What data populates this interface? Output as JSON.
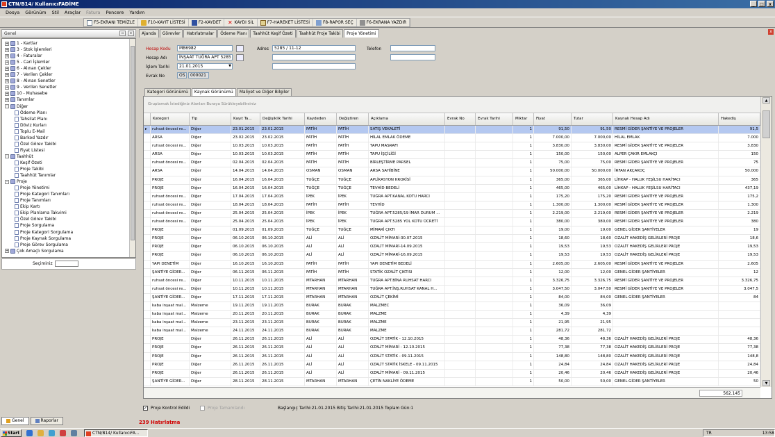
{
  "window": {
    "title": "CTN/B14/ KullanıcıFADİME",
    "controls": [
      "_",
      "□",
      "x"
    ]
  },
  "menu": {
    "items": [
      "Dosya",
      "Görünüm",
      "Stil",
      "Araçlar",
      "Fatura",
      "Pencere",
      "Yardım"
    ],
    "disabled": [
      "Fatura"
    ]
  },
  "toolbar": {
    "buttons": [
      {
        "label": "F5-EKRANI TEMİZLE",
        "icon": "document-icon"
      },
      {
        "label": "F10-KAYIT LİSTESİ",
        "icon": "edit-icon"
      },
      {
        "label": "F2-KAYDET",
        "icon": "save-icon"
      },
      {
        "label": "KAYDI SİL",
        "icon": "delete-icon"
      },
      {
        "label": "F7-HAREKET LİSTESİ",
        "icon": "list-icon"
      },
      {
        "label": "F8-RAPOR SEÇ",
        "icon": "report-icon"
      },
      {
        "label": "F6-EKRANA YAZDIR",
        "icon": "print-icon"
      }
    ]
  },
  "left_panel": {
    "title": "Genel",
    "tree": [
      {
        "label": "1 - Kartlar",
        "level": 0,
        "expander": "+"
      },
      {
        "label": "3 - Stok İşlemleri",
        "level": 0,
        "expander": "+"
      },
      {
        "label": "4 - Faturalar",
        "level": 0,
        "expander": "+"
      },
      {
        "label": "5 - Cari İşlemler",
        "level": 0,
        "expander": "+"
      },
      {
        "label": "6 - Alınan Çekler",
        "level": 0,
        "expander": "+"
      },
      {
        "label": "7 - Verilen Çekler",
        "level": 0,
        "expander": "+"
      },
      {
        "label": "8 - Alınan Senetler",
        "level": 0,
        "expander": "+"
      },
      {
        "label": "9 - Verilen Senetler",
        "level": 0,
        "expander": "+"
      },
      {
        "label": "10 - Muhasebe",
        "level": 0,
        "expander": "+"
      },
      {
        "label": "Tanımlar",
        "level": 0,
        "expander": "+"
      },
      {
        "label": "Diğer",
        "level": 0,
        "expander": "-"
      },
      {
        "label": "Ödeme Planı",
        "level": 1
      },
      {
        "label": "Tahsilat Planı",
        "level": 1
      },
      {
        "label": "Döviz Kurları",
        "level": 1
      },
      {
        "label": "Toplu E-Mail",
        "level": 1
      },
      {
        "label": "Barkod Yazdır",
        "level": 1
      },
      {
        "label": "Özel Görev Takibi",
        "level": 1
      },
      {
        "label": "Fiyat Listesi",
        "level": 1
      },
      {
        "label": "Taahhüt",
        "level": 0,
        "expander": "-"
      },
      {
        "label": "Keşif Özeti",
        "level": 1
      },
      {
        "label": "Proje Takibi",
        "level": 1
      },
      {
        "label": "Taahhüt Tanımlar",
        "level": 1
      },
      {
        "label": "Proje",
        "level": 0,
        "expander": "-"
      },
      {
        "label": "Proje Yönetimi",
        "level": 1
      },
      {
        "label": "Proje Kategori Tanımları",
        "level": 1
      },
      {
        "label": "Proje Tanımları",
        "level": 1
      },
      {
        "label": "Ekip Kartı",
        "level": 1
      },
      {
        "label": "Ekip Planlama Takvimi",
        "level": 1
      },
      {
        "label": "Özel Görev Takibi",
        "level": 1
      },
      {
        "label": "Proje Sorgulama",
        "level": 1
      },
      {
        "label": "Proje Kategori Sorgulama",
        "level": 1
      },
      {
        "label": "Proje Kaynak Sorgulama",
        "level": 1
      },
      {
        "label": "Proje Görev Sorgulama",
        "level": 1
      },
      {
        "label": "Çok Amaçlı Sorgulama",
        "level": 0,
        "expander": "+"
      }
    ],
    "selection_label": "Seçiminiz",
    "bottom_tabs": [
      "Genel",
      "Raporlar"
    ]
  },
  "tabs": [
    "Ajanda",
    "Görevler",
    "Hatırlatmalar",
    "Ödeme Planı",
    "Taahhüt Keşif Özeti",
    "Taahhüt Proje Takibi",
    "Proje Yönetimi"
  ],
  "active_tab": "Proje Yönetimi",
  "form": {
    "hesap_kodu_label": "Hesap Kodu",
    "hesap_kodu": "MB6982",
    "hesap_adi_label": "Hesap Adı",
    "hesap_adi": "İNŞAAT TUĞRA APT 5285",
    "islem_tarihi_label": "İşlem Tarihi",
    "islem_tarihi": "21.01.2015",
    "evrak_no_label": "Evrak No",
    "evrak_seri": "OS",
    "evrak_no": "000021",
    "adres_label": "Adres",
    "adres1": "5285 / 11-12",
    "adres2": "",
    "adres3": "",
    "telefon_label": "Telefon",
    "telefon1": "",
    "telefon2": ""
  },
  "subtabs": [
    "Kategori Görünümü",
    "Kaynak Görünümü",
    "Maliyet ve Diğer Bilgiler"
  ],
  "active_subtab": "Kaynak Görünümü",
  "grid": {
    "group_hint": "Gruplamak İstediğiniz Alanları Buraya Sürükleyebilirsiniz",
    "columns": [
      "Kategori",
      "Tip",
      "Kayıt Ta...",
      "Değişiklik Tarihi",
      "Kaydeden",
      "Değiştiren",
      "Açıklama",
      "Evrak No",
      "Evrak Tarihi",
      "Miktar",
      "Fiyat",
      "Tutar",
      "Kaynak Hesap Adı",
      "Hakediş"
    ],
    "rows": [
      [
        "ruhsat öncesi re...",
        "Diğer",
        "23.01.2015",
        "23.01.2015",
        "FATİH",
        "FATİH",
        "SATIŞ VEKALETİ",
        "",
        "",
        "1",
        "91,50",
        "91,50",
        "RESMİ GİDER ŞANTİYE VE PROJELER",
        "91,5"
      ],
      [
        "ARSA",
        "Diğer",
        "23.02.2015",
        "23.02.2015",
        "FATİH",
        "FATİH",
        "HİLAL EMLAK ÖDEME",
        "",
        "",
        "1",
        "7.000,00",
        "7.000,00",
        "HİLAL EMLAK",
        "7.000"
      ],
      [
        "ruhsat öncesi re...",
        "Diğer",
        "10.03.2015",
        "10.03.2015",
        "FATİH",
        "FATİH",
        "TAPU MASRAFI",
        "",
        "",
        "1",
        "3.830,00",
        "3.830,00",
        "RESMİ GİDER ŞANTİYE VE PROJELER",
        "3.830"
      ],
      [
        "ARSA",
        "Diğer",
        "10.03.2015",
        "10.03.2015",
        "FATİH",
        "FATİH",
        "TAPU İŞÇİLİĞİ",
        "",
        "",
        "1",
        "150,00",
        "150,00",
        "ALPER ÇAKIR EMLAKÇI",
        "150"
      ],
      [
        "ruhsat öncesi re...",
        "Diğer",
        "02.04.2015",
        "02.04.2015",
        "FATİH",
        "FATİH",
        "BİRLEŞTİRME PARSEL",
        "",
        "",
        "1",
        "75,00",
        "75,00",
        "RESMİ GİDER ŞANTİYE VE PROJELER",
        "75"
      ],
      [
        "ARSA",
        "Diğer",
        "14.04.2015",
        "14.04.2015",
        "OSMAN",
        "OSMAN",
        "ARSA SAHİBİNE",
        "",
        "",
        "1",
        "50.000,00",
        "50.000,00",
        "İRFAN AKÇAKOÇ",
        "50.000"
      ],
      [
        "PROJE",
        "Diğer",
        "16.04.2015",
        "16.04.2015",
        "TUĞÇE",
        "TUĞÇE",
        "APLİKASYON KROKİSİ",
        "",
        "",
        "1",
        "365,00",
        "365,00",
        "LİHKAP - HALUK YEŞİLSU HARİTACI",
        "365"
      ],
      [
        "PROJE",
        "Diğer",
        "16.04.2015",
        "16.04.2015",
        "TUĞÇE",
        "TUĞÇE",
        "TEVHİD BEDELİ",
        "",
        "",
        "1",
        "465,00",
        "465,00",
        "LİHKAP - HALUK YEŞİLSU HARİTACI",
        "437,19"
      ],
      [
        "ruhsat öncesi re...",
        "Diğer",
        "17.04.2015",
        "17.04.2015",
        "İPEK",
        "İPEK",
        "TUĞRA APT.KANAL KOTU HARCI",
        "",
        "",
        "1",
        "175,20",
        "175,20",
        "RESMİ GİDER ŞANTİYE VE PROJELER",
        "175,2"
      ],
      [
        "ruhsat öncesi re...",
        "Diğer",
        "18.04.2015",
        "18.04.2015",
        "FATİH",
        "FATİH",
        "TEVHİD",
        "",
        "",
        "1",
        "1.300,00",
        "1.300,00",
        "RESMİ GİDER ŞANTİYE VE PROJELER",
        "1.300"
      ],
      [
        "ruhsat öncesi re...",
        "Diğer",
        "25.04.2015",
        "25.04.2015",
        "İPEK",
        "İPEK",
        "TUĞRA APT.5285/19 İMAR DURUM ...",
        "",
        "",
        "1",
        "2.219,00",
        "2.219,00",
        "RESMİ GİDER ŞANTİYE VE PROJELER",
        "2.219"
      ],
      [
        "ruhsat öncesi re...",
        "Diğer",
        "25.04.2015",
        "25.04.2015",
        "İPEK",
        "İPEK",
        "TUĞRA APT.5285 YOL KOTU ÜCRETİ",
        "",
        "",
        "1",
        "380,00",
        "380,00",
        "RESMİ GİDER ŞANTİYE VE PROJELER",
        "380"
      ],
      [
        "PROJE",
        "Diğer",
        "01.09.2015",
        "01.09.2015",
        "TUĞÇE",
        "TUĞÇE",
        "MİMARİ ÇIKTI",
        "",
        "",
        "1",
        "19,00",
        "19,00",
        "GENEL GİDER ŞANTİYELER",
        "19"
      ],
      [
        "PROJE",
        "Diğer",
        "06.10.2015",
        "06.10.2015",
        "ALİ",
        "ALİ",
        "OZALİT MİMARİ-30.07.2015",
        "",
        "",
        "1",
        "18,60",
        "18,60",
        "OZALİT HAKEDİŞ GELİRLERİ PROJE",
        "18,6"
      ],
      [
        "PROJE",
        "Diğer",
        "06.10.2015",
        "06.10.2015",
        "ALİ",
        "ALİ",
        "OZALİT MİMARİ-14.09.2015",
        "",
        "",
        "1",
        "19,53",
        "19,53",
        "OZALİT HAKEDİŞ GELİRLERİ PROJE",
        "19,53"
      ],
      [
        "PROJE",
        "Diğer",
        "06.10.2015",
        "06.10.2015",
        "ALİ",
        "ALİ",
        "OZALİT MİMARİ-16.09.2015",
        "",
        "",
        "1",
        "19,53",
        "19,53",
        "OZALİT HAKEDİŞ GELİRLERİ PROJE",
        "19,53"
      ],
      [
        "YAPI DENETİM",
        "Diğer",
        "16.10.2015",
        "16.10.2015",
        "FATİH",
        "FATİH",
        "YAPI DENETİM BEDELİ",
        "",
        "",
        "1",
        "2.605,00",
        "2.605,00",
        "RESMİ GİDER ŞANTİYE VE PROJELER",
        "2.605"
      ],
      [
        "ŞANTİYE GİDER...",
        "Diğer",
        "06.11.2015",
        "06.11.2015",
        "FATİH",
        "FATİH",
        "STATİK OZALİT ÇIKTISI",
        "",
        "",
        "1",
        "12,00",
        "12,00",
        "GENEL GİDER ŞANTİYELER",
        "12"
      ],
      [
        "ruhsat öncesi re...",
        "Diğer",
        "10.11.2015",
        "10.11.2015",
        "MTARHAN",
        "MTARHAN",
        "TUĞRA APT.BİNA RUHSAT HARCI",
        "",
        "",
        "1",
        "3.326,75",
        "3.326,75",
        "RESMİ GİDER ŞANTİYE VE PROJELER",
        "3.326,75"
      ],
      [
        "ruhsat öncesi re...",
        "Diğer",
        "10.11.2015",
        "10.11.2015",
        "MTARHAN",
        "MTARHAN",
        "TUĞRA APT.İNŞ.RUHSAT KANAL H...",
        "",
        "",
        "1",
        "3.047,50",
        "3.047,50",
        "RESMİ GİDER ŞANTİYE VE PROJELER",
        "3.047,5"
      ],
      [
        "ŞANTİYE GİDER...",
        "Diğer",
        "17.11.2015",
        "17.11.2015",
        "MTARHAN",
        "MTARHAN",
        "OZALİT ÇEKİMİ",
        "",
        "",
        "1",
        "84,00",
        "84,00",
        "GENEL GİDER ŞANTİYELER",
        "84"
      ],
      [
        "kaba inşaat mal...",
        "Malzeme",
        "19.11.2015",
        "19.11.2015",
        "BURAK",
        "BURAK",
        "MALZMEC",
        "",
        "",
        "1",
        "36,09",
        "36,09",
        "",
        ""
      ],
      [
        "kaba inşaat mal...",
        "Malzeme",
        "20.11.2015",
        "20.11.2015",
        "BURAK",
        "BURAK",
        "MALZME",
        "",
        "",
        "1",
        "4,39",
        "4,39",
        "",
        ""
      ],
      [
        "kaba inşaat mal...",
        "Malzeme",
        "23.11.2015",
        "23.11.2015",
        "BURAK",
        "BURAK",
        "MALZME",
        "",
        "",
        "1",
        "21,95",
        "21,95",
        "",
        ""
      ],
      [
        "kaba inşaat mal...",
        "Malzeme",
        "24.11.2015",
        "24.11.2015",
        "BURAK",
        "BURAK",
        "MALZME",
        "",
        "",
        "1",
        "281,72",
        "281,72",
        "",
        ""
      ],
      [
        "PROJE",
        "Diğer",
        "26.11.2015",
        "26.11.2015",
        "ALİ",
        "ALİ",
        "OZALİT STATİK - 12.10.2015",
        "",
        "",
        "1",
        "48,36",
        "48,36",
        "OZALİT HAKEDİŞ GELİRLERİ PROJE",
        "48,36"
      ],
      [
        "PROJE",
        "Diğer",
        "26.11.2015",
        "26.11.2015",
        "ALİ",
        "ALİ",
        "OZALİT MİMARİ - 12.10.2015",
        "",
        "",
        "1",
        "77,38",
        "77,38",
        "OZALİT HAKEDİŞ GELİRLERİ PROJE",
        "77,38"
      ],
      [
        "PROJE",
        "Diğer",
        "26.11.2015",
        "26.11.2015",
        "ALİ",
        "ALİ",
        "OZALİT STATİK - 09.11.2015",
        "",
        "",
        "1",
        "148,80",
        "148,80",
        "OZALİT HAKEDİŞ GELİRLERİ PROJE",
        "148,8"
      ],
      [
        "PROJE",
        "Diğer",
        "26.11.2015",
        "26.11.2015",
        "ALİ",
        "ALİ",
        "OZALİT STATİK İSKELE - 09.11.2015",
        "",
        "",
        "1",
        "24,84",
        "24,84",
        "OZALİT HAKEDİŞ GELİRLERİ PROJE",
        "24,84"
      ],
      [
        "PROJE",
        "Diğer",
        "26.11.2015",
        "26.11.2015",
        "ALİ",
        "ALİ",
        "OZALİT MİMARİ - 09.11.2015",
        "",
        "",
        "1",
        "20,46",
        "20,46",
        "OZALİT HAKEDİŞ GELİRLERİ PROJE",
        "20,46"
      ],
      [
        "ŞANTİYE GİDER...",
        "Diğer",
        "28.11.2015",
        "28.11.2015",
        "MTARHAN",
        "MTARHAN",
        "ÇETİN NAKLİYE ÖDEME",
        "",
        "",
        "1",
        "50,00",
        "50,00",
        "GENEL GİDER ŞANTİYELER",
        "50"
      ]
    ],
    "total": "562.145"
  },
  "bottom": {
    "proje_kontrol": "Proje Kontrol Edildi",
    "proje_tamamlandi": "Proje Tamamlandı",
    "date_info": "Başlangıç Tarihi:21.01.2015 Bitiş Tarihi:21.01.2015 Toplam Gün:1",
    "reminders": "239 Hatırlatma"
  },
  "taskbar": {
    "start": "Start",
    "task": "CTN/B14/ KullanıcıFA...",
    "lang": "TR",
    "clock": "13:58"
  }
}
